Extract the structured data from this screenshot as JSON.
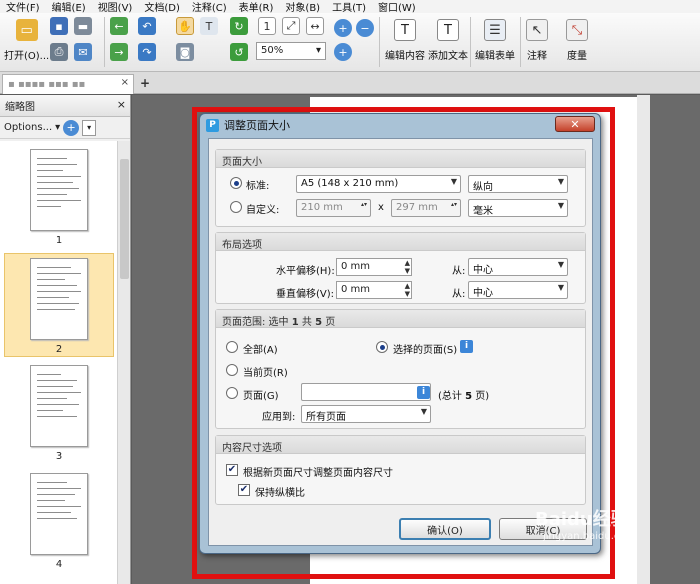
{
  "menu": [
    "文件(F)",
    "编辑(E)",
    "视图(V)",
    "文档(D)",
    "注释(C)",
    "表单(R)",
    "对象(B)",
    "工具(T)",
    "窗口(W)"
  ],
  "toolbar": {
    "open_label": "打开(O)...",
    "zoom_value": "50%",
    "edit_content": "编辑内容",
    "add_text": "添加文本",
    "edit_form": "编辑表单",
    "comment": "注释",
    "measure": "度量"
  },
  "tab": {
    "close": "×",
    "add": "+"
  },
  "sidebar": {
    "title": "缩略图",
    "options": "Options...",
    "thumbnails": [
      "1",
      "2",
      "3",
      "4"
    ]
  },
  "dialog": {
    "title": "调整页面大小",
    "close": "✕",
    "page_size": {
      "heading": "页面大小",
      "standard_label": "标准:",
      "standard_value": "A5 (148 x 210 mm)",
      "orientation": "纵向",
      "custom_label": "自定义:",
      "width": "210 mm",
      "x": "x",
      "height": "297 mm",
      "unit": "毫米"
    },
    "layout": {
      "heading": "布局选项",
      "h_offset_label": "水平偏移(H):",
      "h_offset": "0 mm",
      "v_offset_label": "垂直偏移(V):",
      "v_offset": "0 mm",
      "from_label": "从:",
      "h_from": "中心",
      "v_from": "中心"
    },
    "range": {
      "heading_prefix": "页面范围: 选中 ",
      "selected": "1",
      "heading_mid": " 共 ",
      "total": "5",
      "heading_suffix": " 页",
      "all": "全部(A)",
      "selected_pages": "选择的页面(S)",
      "current": "当前页(R)",
      "pages": "页面(G)",
      "pages_total_prefix": "(总计 ",
      "pages_total_suffix": " 页)",
      "apply_to_label": "应用到:",
      "apply_to": "所有页面"
    },
    "content": {
      "heading": "内容尺寸选项",
      "resize_content": "根据新页面尺寸调整页面内容尺寸",
      "keep_ratio": "保持纵横比"
    },
    "ok": "确认(O)",
    "cancel": "取消(C)"
  },
  "watermark": {
    "main": "Baidu经验",
    "sub": "jingyan.baidu.com"
  }
}
